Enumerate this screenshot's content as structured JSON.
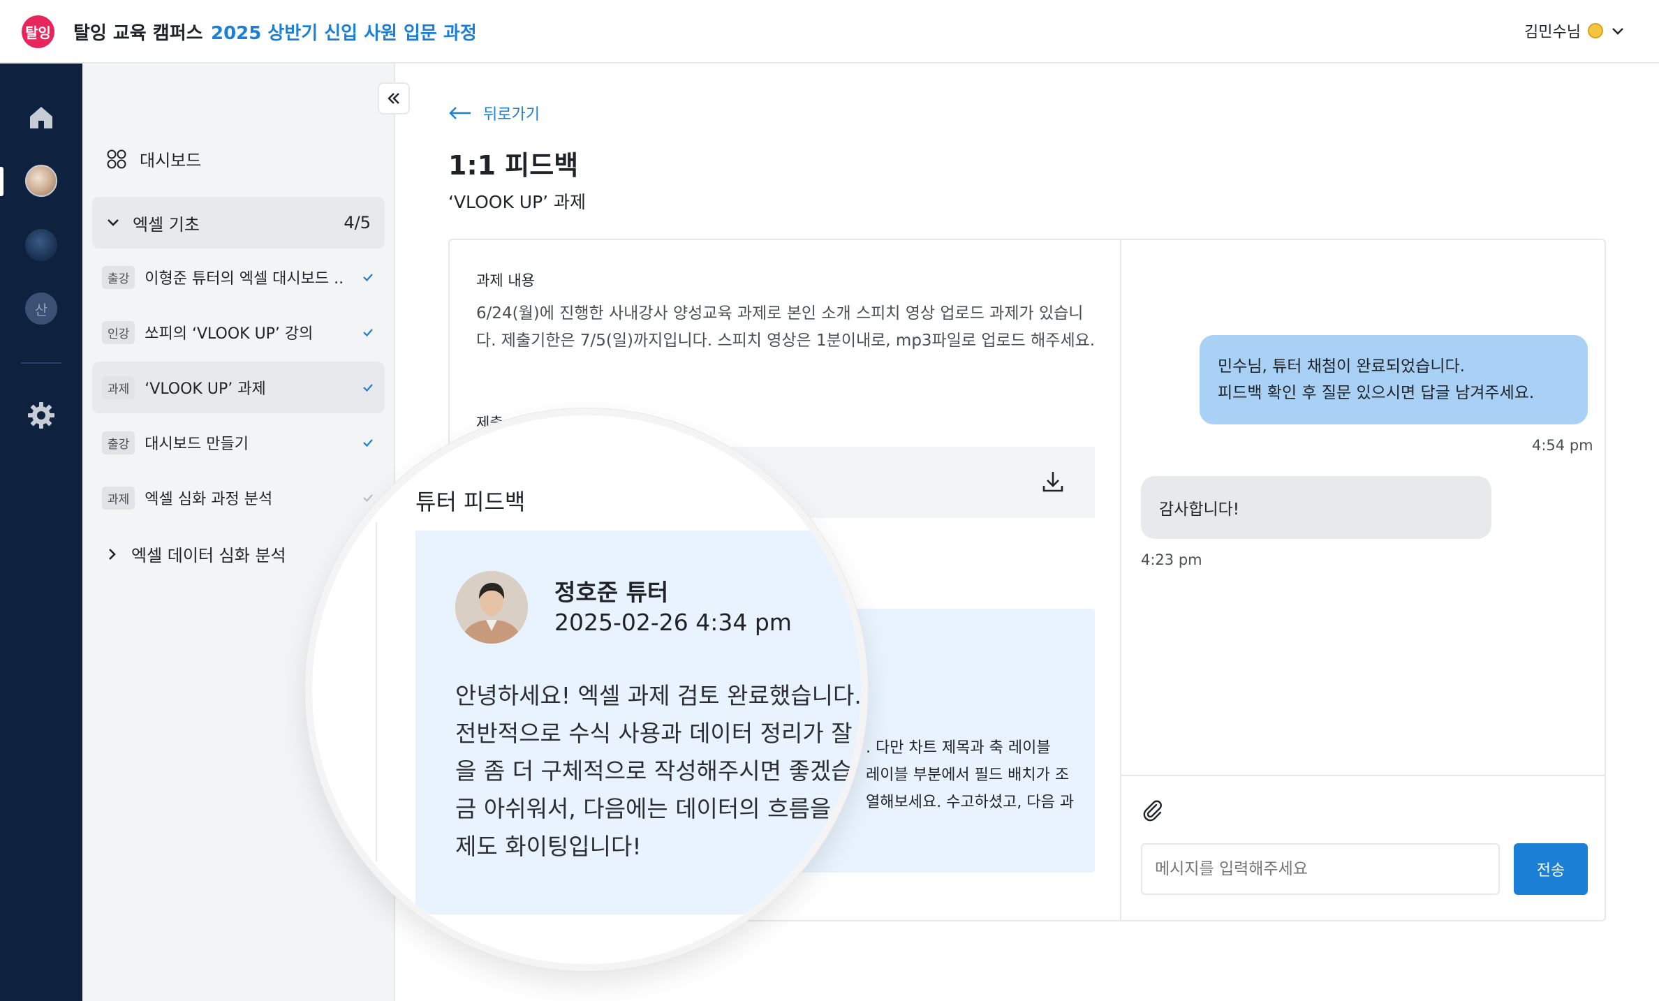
{
  "header": {
    "logo_text": "탈잉",
    "brand": "탈잉 교육 캠퍼스",
    "course": "2025 상반기 신입 사원 입문 과정",
    "user_name": "김민수님"
  },
  "rail": {
    "icons": [
      "home-icon",
      "profile-avatar",
      "globe-avatar",
      "letter-avatar",
      "gear-icon"
    ],
    "letter_avatar": "산"
  },
  "sidebar": {
    "dashboard": "대시보드",
    "section1": {
      "title": "엑셀 기초",
      "count": "4/5"
    },
    "items": [
      {
        "tag": "출강",
        "title": "이형준 튜터의 엑셀 대시보드 ..",
        "done": true
      },
      {
        "tag": "인강",
        "title": "쏘피의 ‘VLOOK UP’ 강의",
        "done": true
      },
      {
        "tag": "과제",
        "title": "‘VLOOK UP’ 과제",
        "done": true
      },
      {
        "tag": "출강",
        "title": "대시보드 만들기",
        "done": true
      },
      {
        "tag": "과제",
        "title": "엑셀 심화 과정 분석",
        "done": false
      }
    ],
    "section2": {
      "title": "엑셀 데이터 심화 분석"
    }
  },
  "main": {
    "back": "뒤로가기",
    "title": "1:1 피드백",
    "subtitle": "‘VLOOK UP’ 과제",
    "task_label": "과제 내용",
    "task_body": "6/24(월)에 진행한 사내강사 양성교육 과제로 본인 소개 스피치 영상 업로드 과제가 있습니다. 제출기한은 7/5(일)까지입니다. 스피치 영상은 1분이내로, mp3파일로 업로드 해주세요.",
    "submit_label_partial": "제출",
    "bg_feedback_lines": [
      ". 다만 차트 제목과 축 레이블",
      "레이블 부분에서 필드 배치가 조",
      "열해보세요. 수고하셨고, 다음 과"
    ]
  },
  "chat": {
    "messages": [
      {
        "side": "right",
        "lines": [
          "민수님, 튜터 채첨이 완료되었습니다.",
          "피드백 확인 후 질문 있으시면 답글 남겨주세요."
        ],
        "time": "4:54 pm"
      },
      {
        "side": "left",
        "lines": [
          "감사합니다!"
        ],
        "time": "4:23 pm"
      }
    ],
    "input_placeholder": "메시지를 입력해주세요",
    "send_label": "전송"
  },
  "feedback": {
    "heading": "튜터 피드백",
    "tutor_name": "정호준 튜터",
    "date": "2025-02-26 4:34 pm",
    "lines": [
      "안녕하세요! 엑셀 과제 검토 완료했습니다.",
      "전반적으로 수식 사용과 데이터 정리가 잘",
      "을 좀 더 구체적으로 작성해주시면 좋겠습",
      "금 아쉬워서, 다음에는 데이터의 흐름을",
      "제도 화이팅입니다!"
    ]
  },
  "colors": {
    "accent": "#1b7fd6",
    "brand_pink": "#e8265e",
    "rail": "#0e2240",
    "bubble_blue": "#a8d1f5",
    "feedback_bg": "#e8f3fd"
  }
}
